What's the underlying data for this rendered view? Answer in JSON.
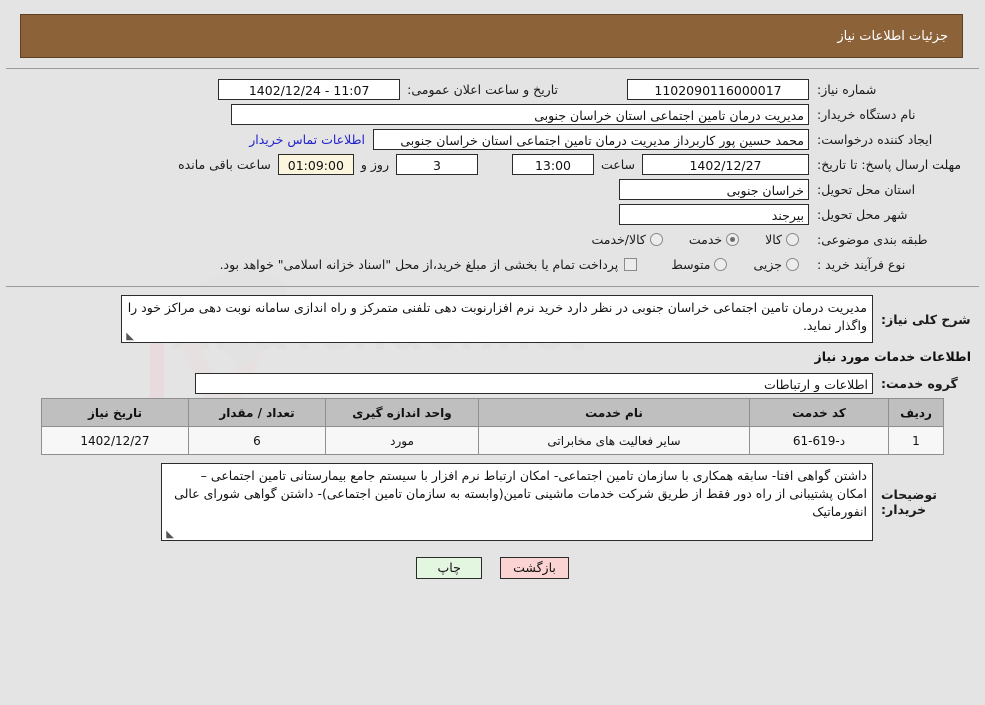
{
  "header": {
    "title": "جزئیات اطلاعات نیاز"
  },
  "fields": {
    "need_number_label": "شماره نیاز:",
    "need_number_value": "1102090116000017",
    "announce_label": "تاریخ و ساعت اعلان عمومی:",
    "announce_value": "11:07 - 1402/12/24",
    "buyer_org_label": "نام دستگاه خریدار:",
    "buyer_org_value": "مدیریت درمان تامین اجتماعی استان خراسان جنوبی",
    "creator_label": "ایجاد کننده درخواست:",
    "creator_value": "محمد حسین پور کاربرداز مدیریت درمان تامین اجتماعی استان خراسان جنوبی",
    "contact_link": "اطلاعات تماس خریدار",
    "deadline_label": "مهلت ارسال پاسخ: تا تاریخ:",
    "deadline_date": "1402/12/27",
    "deadline_hour_label": "ساعت",
    "deadline_hour": "13:00",
    "days_value": "3",
    "days_label": "روز و",
    "countdown_value": "01:09:00",
    "countdown_label": "ساعت باقی مانده",
    "province_label": "استان محل تحویل:",
    "province_value": "خراسان جنوبی",
    "city_label": "شهر محل تحویل:",
    "city_value": "بیرجند",
    "category_label": "طبقه بندی موضوعی:",
    "category_options": [
      {
        "label": "کالا",
        "selected": false
      },
      {
        "label": "خدمت",
        "selected": true
      },
      {
        "label": "کالا/خدمت",
        "selected": false
      }
    ],
    "process_label": "نوع فرآیند خرید :",
    "process_options": [
      {
        "label": "جزیی",
        "selected": false
      },
      {
        "label": "متوسط",
        "selected": false
      }
    ],
    "treasury_checkbox_label": "پرداخت تمام یا بخشی از مبلغ خرید،از محل \"اسناد خزانه اسلامی\" خواهد بود.",
    "treasury_checked": false,
    "summary_label": "شرح کلی نیاز:",
    "summary_value": "مدیریت درمان تامین اجتماعی خراسان جنوبی در نظر دارد خرید نرم افزارنوبت دهی تلفنی متمرکز و راه اندازی سامانه نوبت دهی مراکز خود را واگذار نماید.",
    "services_section_title": "اطلاعات خدمات مورد نیاز",
    "service_group_label": "گروه خدمت:",
    "service_group_value": "اطلاعات و ارتباطات",
    "buyer_notes_label": "توضیحات خریدار:",
    "buyer_notes_value": "داشتن گواهی افتا- سابقه همکاری با سازمان تامین اجتماعی- امکان ارتباط نرم افزار با سیستم جامع بیمارستانی تامین اجتماعی – امکان پشتیبانی از راه دور فقط از طریق شرکت خدمات ماشینی تامین(وابسته به سازمان تامین اجتماعی)- داشتن گواهی شورای عالی انفورماتیک"
  },
  "table": {
    "columns": [
      "ردیف",
      "کد خدمت",
      "نام خدمت",
      "واحد اندازه گیری",
      "تعداد / مقدار",
      "تاریخ نیاز"
    ],
    "rows": [
      {
        "index": "1",
        "code": "د-619-61",
        "name": "سایر فعالیت های مخابراتی",
        "unit": "مورد",
        "qty": "6",
        "date": "1402/12/27"
      }
    ]
  },
  "buttons": {
    "back": "بازگشت",
    "print": "چاپ"
  },
  "watermark": {
    "text": "AriaTender.net"
  },
  "colors": {
    "header_bg": "#8c6239",
    "link": "#2222cc",
    "back_btn": "#fbd3d3",
    "print_btn": "#e3f6e0",
    "table_header": "#bfbfbf",
    "countdown_bg": "#fbf6dd"
  }
}
